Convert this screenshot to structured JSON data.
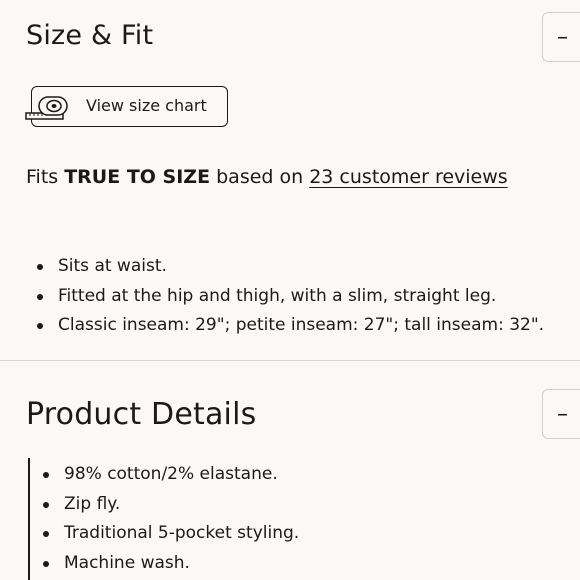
{
  "size_fit": {
    "title": "Size & Fit",
    "toggle_symbol": "–",
    "size_chart_button": {
      "label": "View size chart",
      "icon": "measuring-tape-icon"
    },
    "fit": {
      "prefix": "Fits ",
      "rating": "TRUE TO SIZE",
      "middle": " based on ",
      "reviews_link": "23 customer reviews"
    },
    "bullets": [
      "Sits at waist.",
      "Fitted at the hip and thigh, with a slim, straight leg.",
      "Classic inseam: 29\"; petite inseam: 27\"; tall inseam: 32\"."
    ]
  },
  "product_details": {
    "title": "Product Details",
    "toggle_symbol": "–",
    "bullets": [
      "98% cotton/2% elastane.",
      "Zip fly.",
      "Traditional 5-pocket styling.",
      "Machine wash."
    ]
  }
}
